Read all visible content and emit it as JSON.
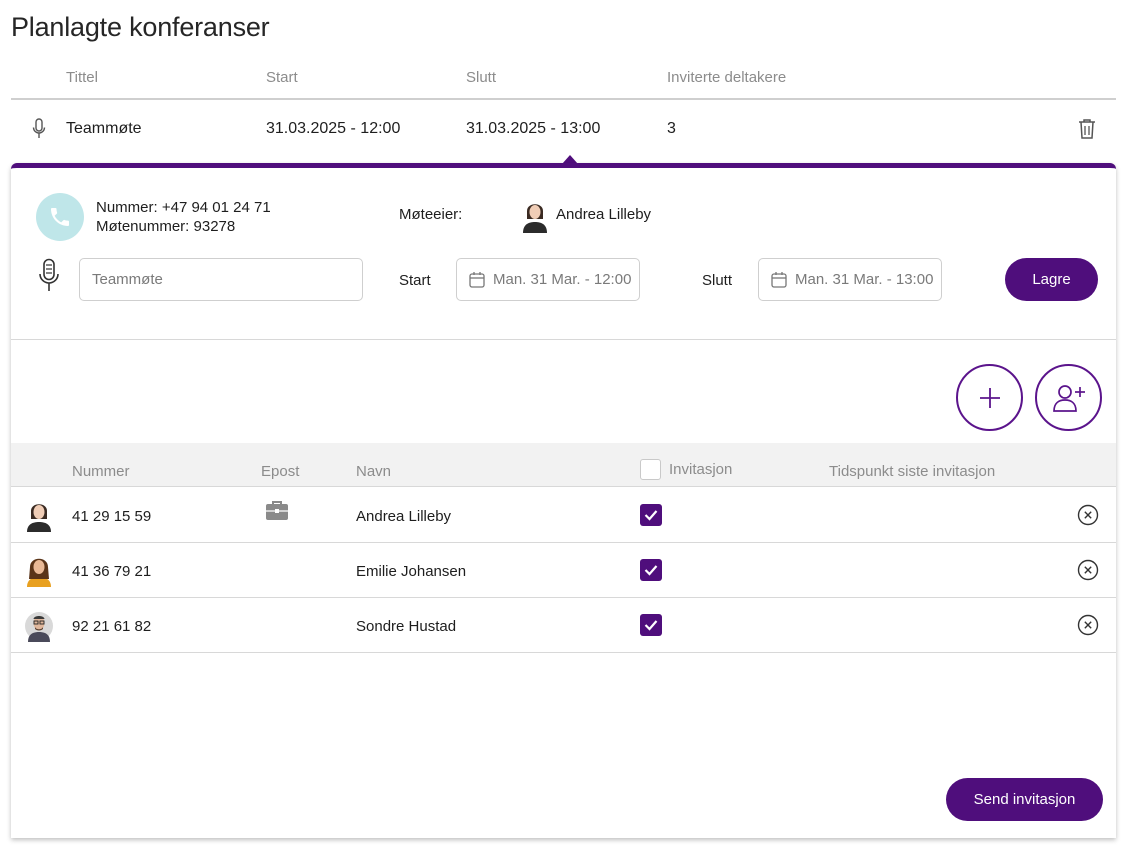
{
  "page": {
    "title": "Planlagte konferanser"
  },
  "conferences": {
    "headers": {
      "title": "Tittel",
      "start": "Start",
      "end": "Slutt",
      "invited": "Inviterte deltakere"
    },
    "row": {
      "title": "Teammøte",
      "start": "31.03.2025 - 12:00",
      "end": "31.03.2025 - 13:00",
      "invited": "3"
    }
  },
  "details": {
    "number_line": "Nummer: +47 94 01 24 71",
    "meeting_number_line": "Møtenummer: 93278",
    "owner_label": "Møteeier:",
    "owner_name": "Andrea Lilleby",
    "title_placeholder": "Teammøte",
    "start_label": "Start",
    "start_value": "Man. 31 Mar. - 12:00",
    "end_label": "Slutt",
    "end_value": "Man. 31 Mar. - 13:00",
    "save_label": "Lagre"
  },
  "participants": {
    "headers": {
      "number": "Nummer",
      "email": "Epost",
      "name": "Navn",
      "invitation": "Invitasjon",
      "last_invite": "Tidspunkt siste invitasjon"
    },
    "rows": [
      {
        "number": "41 29 15 59",
        "name": "Andrea Lilleby",
        "invited": true,
        "has_email": true
      },
      {
        "number": "41 36 79 21",
        "name": "Emilie Johansen",
        "invited": true,
        "has_email": false
      },
      {
        "number": "92 21 61 82",
        "name": "Sondre Hustad",
        "invited": true,
        "has_email": false
      }
    ]
  },
  "actions": {
    "send_label": "Send invitasjon"
  },
  "colors": {
    "accent": "#4f0e7c",
    "phone_bg": "#bfe6e9",
    "header_bg": "#f2f2f2"
  },
  "icons": [
    "microphone-icon",
    "trash-icon",
    "phone-icon",
    "calendar-icon",
    "plus-icon",
    "add-user-icon",
    "briefcase-icon",
    "check-icon",
    "close-circle-icon"
  ]
}
